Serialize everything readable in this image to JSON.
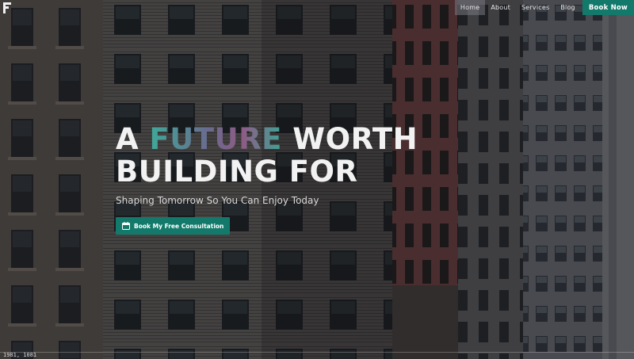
{
  "nav": {
    "items": [
      {
        "label": "Home",
        "active": true
      },
      {
        "label": "About",
        "active": false
      },
      {
        "label": "Services",
        "active": false
      },
      {
        "label": "Blog",
        "active": false
      }
    ],
    "cta_label": "Book Now"
  },
  "hero": {
    "line1_word1": "A",
    "line1_accent": "FUTURE",
    "line1_word3": "WORTH",
    "line2": "BUILDING FOR",
    "subtitle": "Shaping Tomorrow So You Can Enjoy Today",
    "cta_label": "Book My Free Consultation"
  },
  "footer": {
    "coords": "1981, 1081"
  },
  "colors": {
    "accent": "#137a6b",
    "accent_gradient": [
      "#3fa89a",
      "#8e5b86"
    ],
    "text": "#f2f2f2"
  },
  "icons": {
    "logo": "brand-logo-icon",
    "cta": "calendar-icon"
  }
}
